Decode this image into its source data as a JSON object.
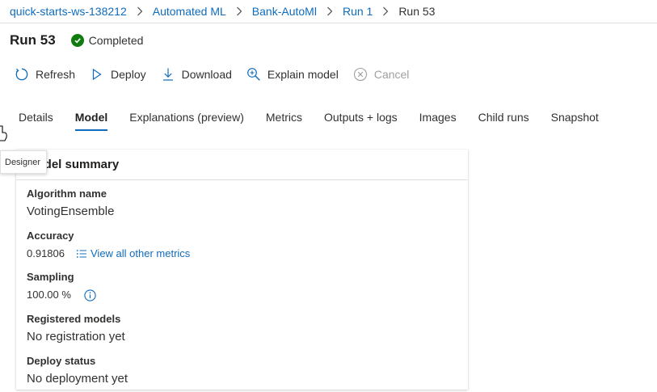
{
  "breadcrumb": [
    {
      "label": "quick-starts-ws-138212"
    },
    {
      "label": "Automated ML"
    },
    {
      "label": "Bank-AutoMl"
    },
    {
      "label": "Run 1"
    },
    {
      "label": "Run 53"
    }
  ],
  "header": {
    "title": "Run 53",
    "status": "Completed",
    "status_color": "#107c10"
  },
  "toolbar": {
    "refresh": "Refresh",
    "deploy": "Deploy",
    "download": "Download",
    "explain": "Explain model",
    "cancel": "Cancel"
  },
  "tabs": [
    {
      "label": "Details"
    },
    {
      "label": "Model",
      "active": true
    },
    {
      "label": "Explanations (preview)"
    },
    {
      "label": "Metrics"
    },
    {
      "label": "Outputs + logs"
    },
    {
      "label": "Images"
    },
    {
      "label": "Child runs"
    },
    {
      "label": "Snapshot"
    }
  ],
  "tooltip": "Designer",
  "card": {
    "title": "Model summary",
    "algorithm_label": "Algorithm name",
    "algorithm_value": "VotingEnsemble",
    "accuracy_label": "Accuracy",
    "accuracy_value": "0.91806",
    "metrics_link": "View all other metrics",
    "sampling_label": "Sampling",
    "sampling_value": "100.00 %",
    "registered_label": "Registered models",
    "registered_value": "No registration yet",
    "deploy_label": "Deploy status",
    "deploy_value": "No deployment yet"
  },
  "colors": {
    "accent": "#0f6cbd",
    "text": "#323130",
    "disabled": "#a19f9d"
  }
}
